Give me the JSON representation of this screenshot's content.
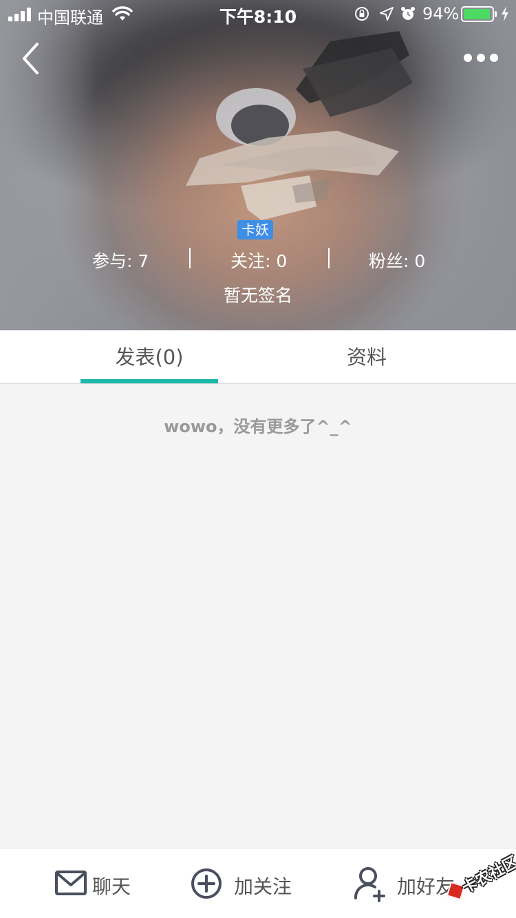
{
  "status_bar": {
    "carrier": "中国联通",
    "time": "下午8:10",
    "battery_percent": "94%",
    "battery_level": 0.94,
    "icons": [
      "signal-icon",
      "wifi-icon",
      "rotation-lock-icon",
      "location-icon",
      "alarm-icon",
      "battery-icon",
      "charging-icon"
    ]
  },
  "nav": {
    "back_icon": "chevron-left-icon",
    "more_icon": "more-dots-icon"
  },
  "profile": {
    "username_tag": "卡妖",
    "stats": [
      {
        "label": "参与: 7"
      },
      {
        "label": "关注: 0"
      },
      {
        "label": "粉丝: 0"
      }
    ],
    "signature": "暂无签名"
  },
  "tabs": [
    {
      "label": "发表(0)",
      "active": true
    },
    {
      "label": "资料",
      "active": false
    }
  ],
  "feed": {
    "empty_message": "wowo，没有更多了^_^"
  },
  "bottom_bar": {
    "chat_label": "聊天",
    "follow_label": "加关注",
    "add_friend_label": "加好友"
  },
  "watermark": "卡农社区",
  "colors": {
    "accent": "#1ab9a8",
    "tag_bg": "#3e8ee6",
    "battery": "#4cd964",
    "icon": "#4a4f5e"
  }
}
